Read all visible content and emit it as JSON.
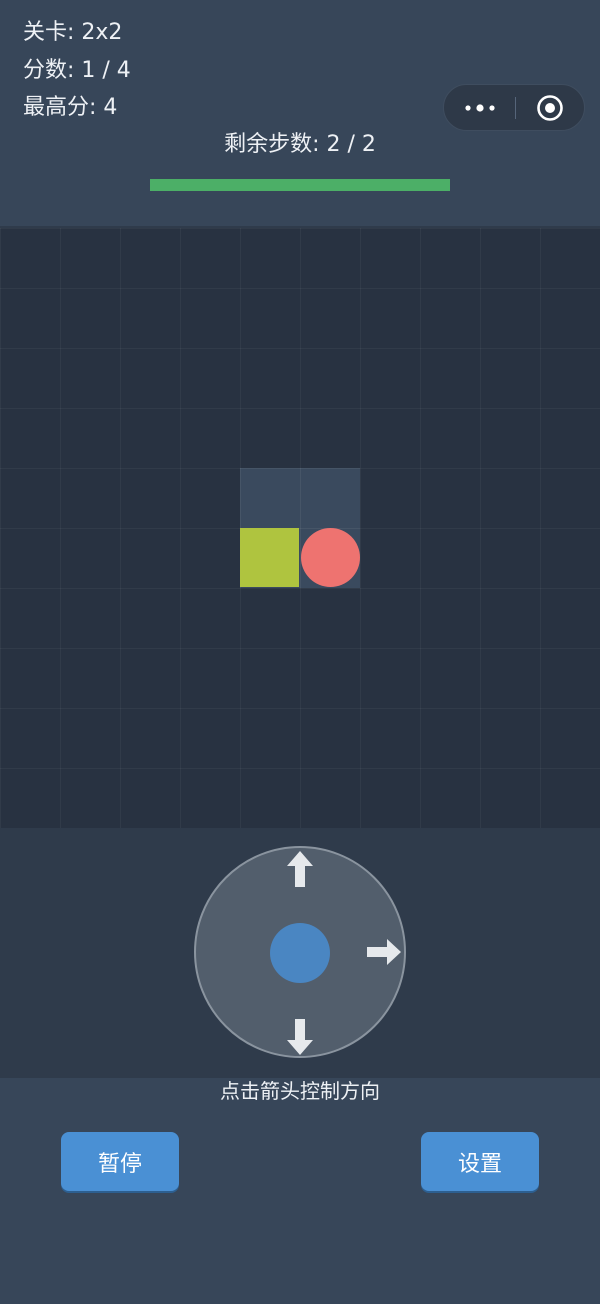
{
  "header": {
    "level_text": "关卡: 2x2",
    "score_text": "分数: 1 / 4",
    "best_text": "最高分: 4",
    "steps_text": "剩余步数: 2 / 2",
    "steps_progress": 1.0,
    "progress_color": "#4caf67"
  },
  "capsule": {
    "more_icon": "more-dots-icon",
    "close_icon": "target-circle-icon"
  },
  "board": {
    "grid_columns": 10,
    "grid_rows": 10,
    "play_area_size": "2x2",
    "snake_color": "#afc43f",
    "food_color": "#ee7370"
  },
  "controls": {
    "hint": "点击箭头控制方向",
    "center_color": "#4a86c2",
    "arrows": [
      "arrow-up-icon",
      "arrow-right-icon",
      "arrow-down-icon"
    ]
  },
  "buttons": {
    "pause_label": "暂停",
    "settings_label": "设置",
    "color": "#4a90d4"
  }
}
